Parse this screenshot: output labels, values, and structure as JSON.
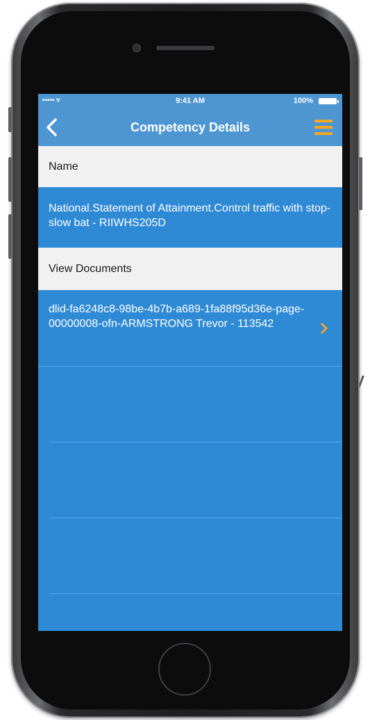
{
  "background": {
    "partial_letter": "y"
  },
  "status_bar": {
    "signal": "••••• ▿",
    "time": "9:41 AM",
    "battery": "100%"
  },
  "nav": {
    "title": "Competency Details"
  },
  "sections": {
    "name_header": "Name",
    "name_value": "National.Statement of Attainment.Control traffic with stop-slow bat - RIIWHS205D",
    "documents_header": "View Documents"
  },
  "documents": [
    {
      "label": "dlid-fa6248c8-98be-4b7b-a689-1fa88f95d36e-page-00000008-ofn-ARMSTRONG Trevor - 113542"
    }
  ],
  "empty_rows": 3,
  "colors": {
    "nav_blue": "#4e96d1",
    "content_blue": "#2f8ad6",
    "accent_orange": "#f5a623",
    "section_gray": "#f1f1f1"
  },
  "icons": {
    "back": "chevron-left-icon",
    "menu": "hamburger-menu-icon",
    "row": "chevron-right-icon"
  }
}
